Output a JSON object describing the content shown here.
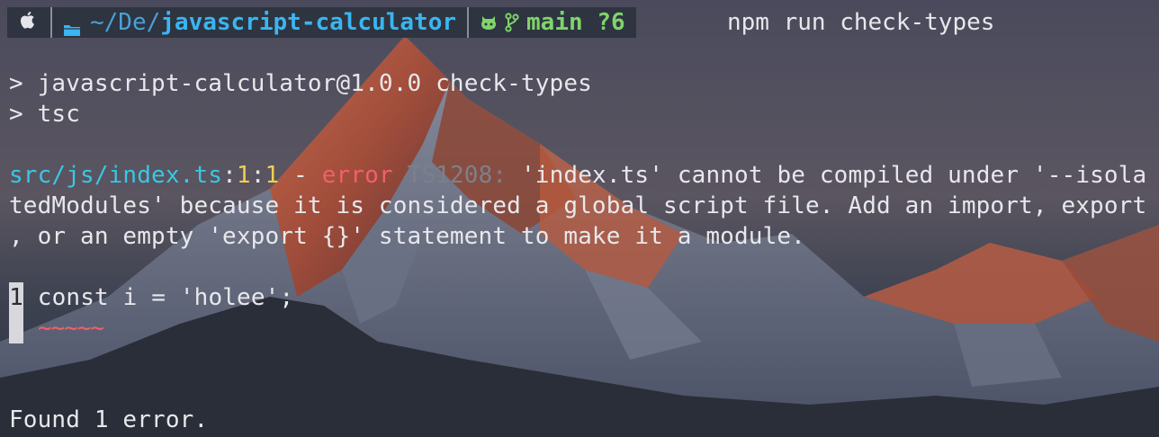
{
  "prompt": {
    "apple_icon": "apple-logo-icon",
    "folder_icon": "folder-icon",
    "path_prefix": "~/De/",
    "path_current": "javascript-calculator",
    "git_icon": "github-icon",
    "branch_icon": "git-branch-icon",
    "branch": "main",
    "status": "?6",
    "command": "npm run check-types"
  },
  "output": {
    "script_line": "> javascript-calculator@1.0.0 check-types",
    "tsc_line": "> tsc",
    "error": {
      "file": "src/js/index.ts",
      "sep1": ":",
      "line": "1",
      "sep2": ":",
      "col": "1",
      "dash": " - ",
      "label": "error",
      "code": " TS1208: ",
      "message_1": "'index.ts' cannot be compiled under '--isola",
      "message_2": "tedModules' because it is considered a global script file. Add an import, export",
      "message_3": ", or an empty 'export {}' statement to make it a module."
    },
    "code_line_number": "1",
    "code_text": " const i = 'holee';",
    "squiggle": "~~~~~",
    "summary": "Found 1 error."
  },
  "colors": {
    "path": "#39b6f2",
    "git": "#7fd46a",
    "error": "#f0606a",
    "file": "#39c7e4",
    "position": "#f0d050"
  }
}
